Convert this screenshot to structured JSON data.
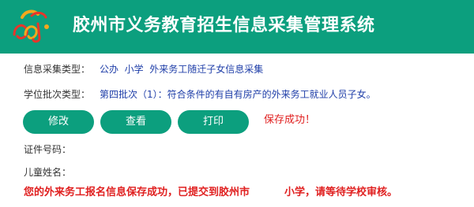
{
  "header": {
    "title": "胶州市义务教育招生信息采集管理系统"
  },
  "info": {
    "type_label": "信息采集类型：",
    "type_value": "公办  小学  外来务工随迁子女信息采集",
    "batch_label": "学位批次类型：",
    "batch_value": "第四批次（1）：符合条件的有自有房产的外来务工就业人员子女。"
  },
  "actions": {
    "modify_label": "修改",
    "view_label": "查看",
    "print_label": "打印",
    "save_status": "保存成功！"
  },
  "fields": {
    "id_label": "证件号码：",
    "id_value": "",
    "name_label": "儿童姓名：",
    "name_value": ""
  },
  "notice": {
    "part1": "您的外来务工报名信息保存成功，已提交到胶州市",
    "part2": "小学，请等待学校审核。"
  },
  "colors": {
    "brand": "#0c9f7e",
    "error": "#e02020",
    "link": "#1f3ea8"
  },
  "icons": {
    "logo": "school-logo-icon"
  }
}
